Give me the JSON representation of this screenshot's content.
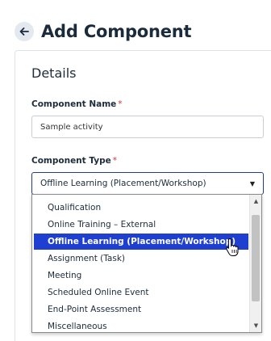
{
  "page": {
    "title": "Add Component"
  },
  "details": {
    "heading": "Details",
    "component_name": {
      "label": "Component Name",
      "value": "Sample activity"
    },
    "component_type": {
      "label": "Component Type",
      "selected": "Offline Learning (Placement/Workshop)",
      "options": [
        "Qualification",
        "Online Training – External",
        "Offline Learning (Placement/Workshop)",
        "Assignment (Task)",
        "Meeting",
        "Scheduled Online Event",
        "End-Point Assessment",
        "Miscellaneous"
      ],
      "highlighted_index": 2
    }
  },
  "required_marker": "*",
  "icons": {
    "back": "arrow-left-icon",
    "select": "triangle-down-icon",
    "cursor": "hand-pointer-icon"
  },
  "colors": {
    "highlight": "#1e3fd0",
    "required": "#d0363a",
    "title": "#1a2b3c"
  }
}
